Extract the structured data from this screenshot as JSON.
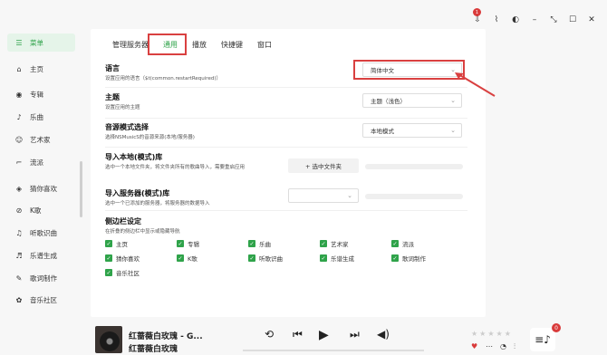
{
  "titlebar": {
    "badge_count": "1",
    "icons": [
      "download-icon",
      "broom-icon",
      "contrast-icon",
      "minimize-icon",
      "restore-icon",
      "maximize-icon",
      "close-icon"
    ]
  },
  "sidebar": {
    "items": [
      {
        "label": "菜单",
        "icon": "menu-icon",
        "active": true
      },
      {
        "label": "主页",
        "icon": "home-icon"
      },
      {
        "label": "专辑",
        "icon": "disc-icon"
      },
      {
        "label": "乐曲",
        "icon": "note-icon"
      },
      {
        "label": "艺术家",
        "icon": "artist-icon"
      },
      {
        "label": "流派",
        "icon": "genre-icon"
      },
      {
        "label": "猜你喜欢",
        "icon": "recommend-icon"
      },
      {
        "label": "K歌",
        "icon": "karaoke-icon"
      },
      {
        "label": "听歌识曲",
        "icon": "recognize-icon"
      },
      {
        "label": "乐谱生成",
        "icon": "score-icon"
      },
      {
        "label": "歌词制作",
        "icon": "lyrics-icon"
      },
      {
        "label": "音乐社区",
        "icon": "community-icon"
      }
    ]
  },
  "tabs": [
    "管理服务器",
    "通用",
    "播放",
    "快捷键",
    "窗口"
  ],
  "settings": {
    "language": {
      "title": "语言",
      "desc": "设置应用的语言（$t(common.restartRequired)）",
      "value": "简体中文"
    },
    "theme": {
      "title": "主题",
      "desc": "设置应用的主题",
      "value": "主题（浅色）"
    },
    "source": {
      "title": "音源模式选择",
      "desc": "选择NSMusicS的音源来源(本地/服务器)",
      "value": "本地模式"
    },
    "local_lib": {
      "title": "导入本地(模式)库",
      "desc": "选中一个本地文件夹，将文件夹所有的歌曲导入，需要重启应用",
      "button": "+ 选中文件夹"
    },
    "server_lib": {
      "title": "导入服务器(模式)库",
      "desc": "选中一个已添加的服务器，将服务器的数据导入"
    },
    "sidebar_settings": {
      "title": "侧边栏设定",
      "desc": "在折叠的侧边栏中显示或隐藏导航"
    }
  },
  "checkboxes": [
    [
      "主页",
      "专辑",
      "乐曲",
      "艺术家",
      "流派"
    ],
    [
      "猜你喜欢",
      "K歌",
      "听歌识曲",
      "乐谱生成",
      "歌词制作"
    ],
    [
      "音乐社区"
    ]
  ],
  "player": {
    "title": "红蔷薇白玫瑰 - G...",
    "subtitle": "红蔷薇白玫瑰",
    "queue_badge": "0",
    "stars": "★★★★★"
  },
  "colors": {
    "accent": "#2fa34a",
    "annotation": "#d94040"
  }
}
